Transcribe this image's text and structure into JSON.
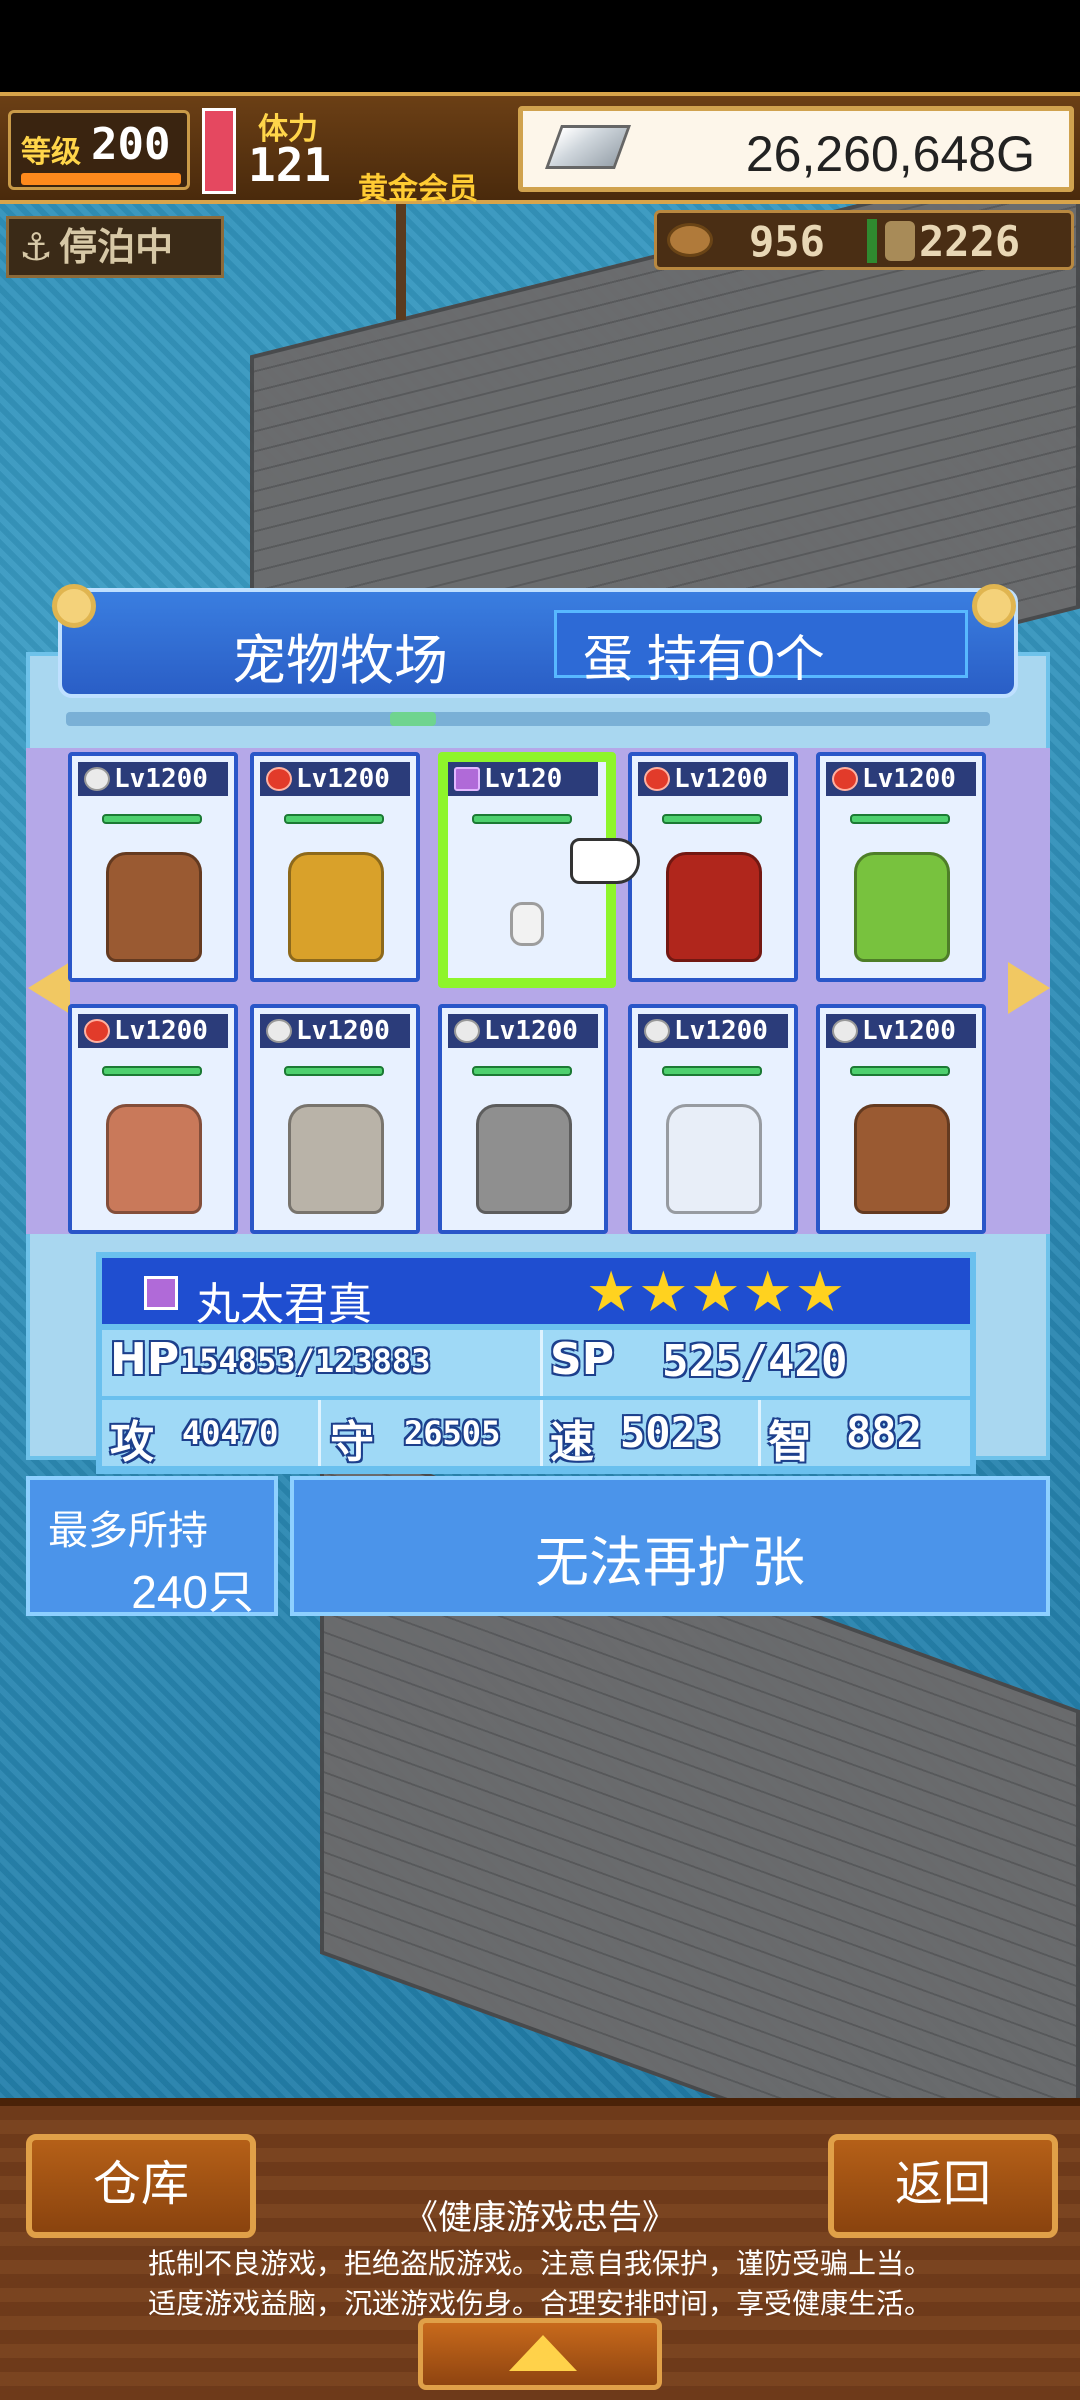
{
  "hud": {
    "level_label": "等级",
    "level_value": "200",
    "stamina_label": "体力",
    "stamina_value": "121",
    "membership": "黄金会员",
    "money": "26,260,648G",
    "dock_status": "停泊中",
    "resource1": "956",
    "resource2": "2226"
  },
  "panel": {
    "title": "宠物牧场",
    "eggs": "蛋 持有0个"
  },
  "pets": [
    {
      "level": "Lv1200",
      "element": "neutral",
      "color": "#9a5a32",
      "selected": false
    },
    {
      "level": "Lv1200",
      "element": "fire",
      "color": "#d9a12a",
      "selected": false
    },
    {
      "level": "Lv120",
      "element": "magic",
      "color": "#f2f2f2",
      "selected": true
    },
    {
      "level": "Lv1200",
      "element": "fire",
      "color": "#b0261c",
      "selected": false
    },
    {
      "level": "Lv1200",
      "element": "fire",
      "color": "#78c23e",
      "selected": false
    },
    {
      "level": "Lv1200",
      "element": "fire",
      "color": "#c9795a",
      "selected": false
    },
    {
      "level": "Lv1200",
      "element": "neutral",
      "color": "#b9b3a8",
      "selected": false
    },
    {
      "level": "Lv1200",
      "element": "neutral",
      "color": "#8f8f8f",
      "selected": false
    },
    {
      "level": "Lv1200",
      "element": "neutral",
      "color": "#e8eef8",
      "selected": false
    },
    {
      "level": "Lv1200",
      "element": "neutral",
      "color": "#9a5a32",
      "selected": false
    }
  ],
  "detail": {
    "name": "丸太君真",
    "stars": "★★★★★",
    "hp_label": "HP",
    "hp_value": "154853/123883",
    "sp_label": "SP",
    "sp_value": "525/420",
    "atk_label": "攻",
    "atk_value": "40470",
    "def_label": "守",
    "def_value": "26505",
    "spd_label": "速",
    "spd_value": "5023",
    "int_label": "智",
    "int_value": "882"
  },
  "capacity": {
    "label": "最多所持",
    "value": "240只",
    "expand": "无法再扩张"
  },
  "bottom": {
    "warehouse": "仓库",
    "back": "返回",
    "warning_title": "《健康游戏忠告》",
    "warning_line1": "抵制不良游戏，拒绝盗版游戏。注意自我保护，谨防受骗上当。",
    "warning_line2": "适度游戏益脑，沉迷游戏伤身。合理安排时间，享受健康生活。"
  }
}
